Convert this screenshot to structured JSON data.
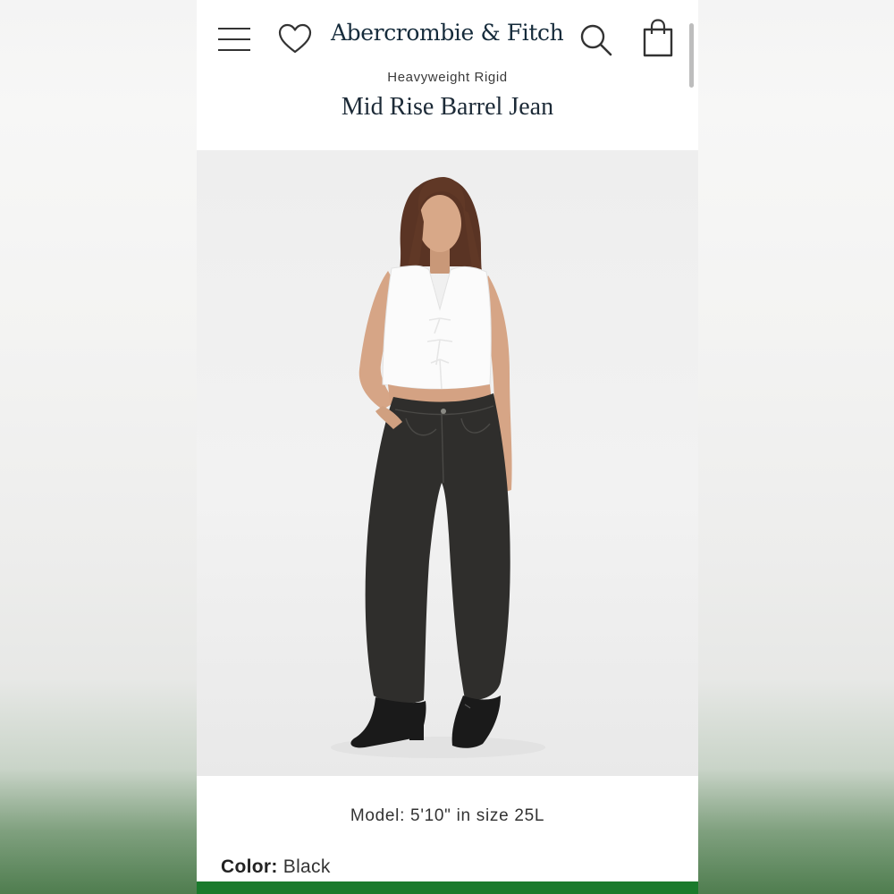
{
  "header": {
    "brand": "Abercrombie & Fitch",
    "icons": {
      "menu": "hamburger-menu-icon",
      "wishlist": "heart-icon",
      "search": "search-icon",
      "bag": "shopping-bag-icon"
    }
  },
  "product": {
    "subtitle": "Heavyweight Rigid",
    "title": "Mid Rise Barrel Jean",
    "model_info": "Model: 5'10\" in size 25L",
    "color": {
      "label": "Color:",
      "value": "Black"
    }
  },
  "colors": {
    "brand_navy": "#152b3b",
    "text": "#333333",
    "bottom_bar": "#1a7a2c"
  }
}
